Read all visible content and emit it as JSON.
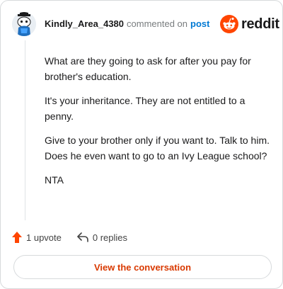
{
  "comment": {
    "username": "Kindly_Area_4380",
    "action_text": "commented on",
    "post_link": "post",
    "paragraphs": [
      "What are they going to ask for after you pay for brother's education.",
      "It's your inheritance. They are not entitled to a penny.",
      "Give to your brother only if you want to. Talk to him. Does he even want to go to an Ivy League school?",
      "NTA"
    ]
  },
  "brand": {
    "logo_text": "reddit",
    "icon": "reddit-snoo-icon",
    "color": "#ff4500"
  },
  "actions": {
    "upvote_label": "1 upvote",
    "upvote_icon": "upvote-arrow-icon",
    "upvote_color": "#ff4500",
    "replies_label": "0 replies",
    "replies_icon": "reply-arrow-icon"
  },
  "cta": {
    "label": "View the conversation",
    "color": "#d93900"
  }
}
